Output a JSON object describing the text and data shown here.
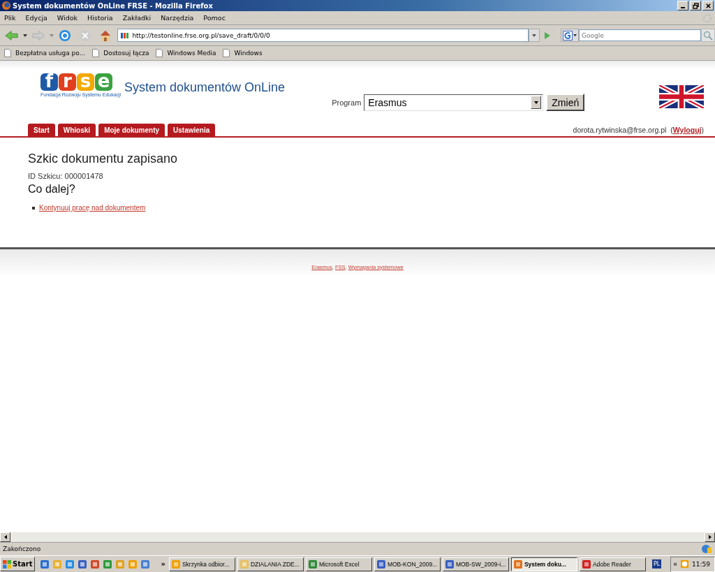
{
  "window": {
    "title": "System dokumentów OnLine FRSE - Mozilla Firefox"
  },
  "menu": [
    "Plik",
    "Edycja",
    "Widok",
    "Historia",
    "Zakładki",
    "Narzędzia",
    "Pomoc"
  ],
  "address": {
    "value": "http://testonline.frse.org.pl/save_draft/0/0/0"
  },
  "search": {
    "placeholder": "Google"
  },
  "bookmarks": [
    "Bezpłatna usługa po...",
    "Dostosuj łącza",
    "Windows Media",
    "Windows"
  ],
  "page": {
    "logo": {
      "letters": [
        "f",
        "r",
        "s",
        "e"
      ],
      "subtitle": "Fundacja Rozwoju Systemu Edukacji"
    },
    "site_title": "System dokumentów OnLine",
    "program": {
      "label": "Program",
      "value": "Erasmus",
      "button": "Zmień"
    },
    "tabs": [
      "Start",
      "Whioski",
      "Moje dokumenty",
      "Ustawienia"
    ],
    "user": {
      "email": "dorota.rytwinska@frse.org.pl",
      "open": "(",
      "logout": "Wyloguj",
      "close": ")"
    },
    "heading": "Szkic dokumentu zapisano",
    "draft_id": "ID Szkicu: 000001478",
    "subheading": "Co dalej?",
    "links": [
      "Kontynuuj pracę nad dokumentem"
    ],
    "footer": [
      {
        "kind": "link",
        "text": "Erasmus"
      },
      {
        "kind": "text",
        "text": ", "
      },
      {
        "kind": "link",
        "text": "FSS"
      },
      {
        "kind": "text",
        "text": ", "
      },
      {
        "kind": "link",
        "text": "Wymagania systemowe"
      }
    ]
  },
  "status_bar": "Zakończono",
  "taskbar": {
    "start": "Start",
    "more": "»",
    "tasks": [
      {
        "kind": "clock",
        "label": "Skrzynka odbior...",
        "selected": false
      },
      {
        "kind": "folder",
        "label": "DZIALANIA ZDE...",
        "selected": false
      },
      {
        "kind": "excel",
        "label": "Microsoft Excel",
        "selected": false
      },
      {
        "kind": "word",
        "label": "MOB-KON_2009...",
        "selected": false
      },
      {
        "kind": "word",
        "label": "MOB-SW_2009-i...",
        "selected": false
      },
      {
        "kind": "firefox",
        "label": "System doku...",
        "selected": true
      },
      {
        "kind": "pdf",
        "label": "Adobe Reader",
        "selected": false
      }
    ],
    "language": "PL",
    "tray_toggle": "«",
    "clock": "11:59"
  }
}
